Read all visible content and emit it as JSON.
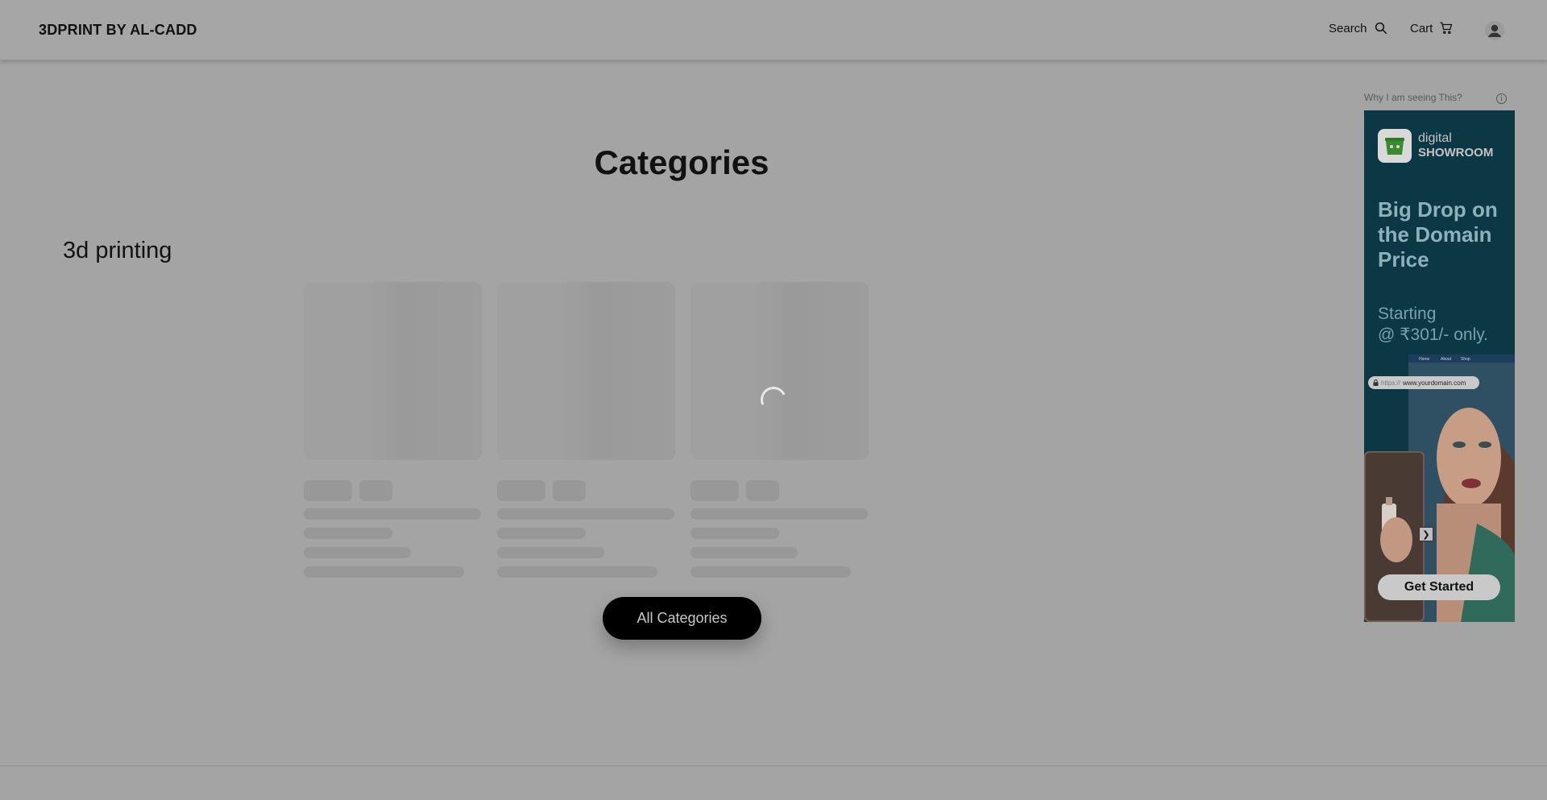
{
  "header": {
    "brand": "3DPRINT BY AL-CADD",
    "search_label": "Search",
    "cart_label": "Cart",
    "icons": {
      "search": "search-icon",
      "cart": "cart-icon",
      "account": "user-avatar-icon"
    }
  },
  "main": {
    "page_title": "Categories",
    "section_title": "3d printing",
    "products_loading": true,
    "skeleton_cards": 3,
    "all_categories_label": "All Categories"
  },
  "ad": {
    "why_text": "Why I am seeing This?",
    "info_icon": "i",
    "brand_line1": "digital",
    "brand_line2": "SHOWROOM",
    "headline": "Big Drop on the Domain Price",
    "subline1": "Starting",
    "subline2": "@ ₹301/- only.",
    "nav_items": [
      "Home",
      "About",
      "Shop"
    ],
    "url_prefix": "https://",
    "url_text": "www.yourdomain.com",
    "cta": "Get Started",
    "colors": {
      "background": "#0c3745",
      "headline": "#8eb0bb",
      "logo_green": "#3a8a2e"
    }
  },
  "theme": {
    "overlay_background": "#a4a4a4",
    "button_bg": "#000000"
  }
}
